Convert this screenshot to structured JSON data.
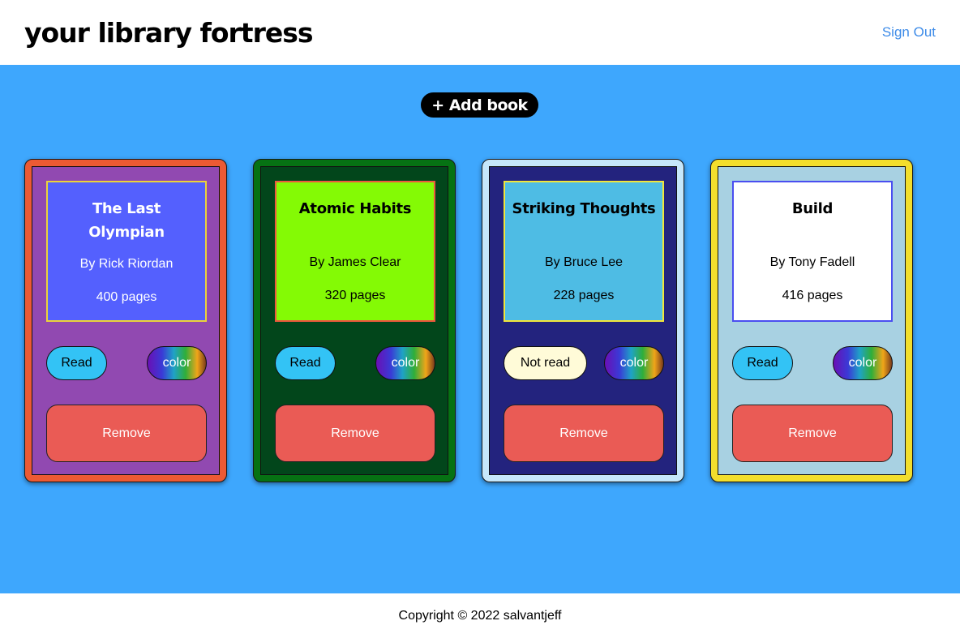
{
  "header": {
    "logo": "your library fortress",
    "sign_out": "Sign Out"
  },
  "main": {
    "add_book_label": "+ Add book"
  },
  "books": [
    {
      "title": "The Last Olympian",
      "author": "By Rick Riordan",
      "pages": "400 pages",
      "status": "Read",
      "color_label": "color",
      "remove_label": "Remove",
      "colors": {
        "outer": "#ec5a33",
        "inner": "#9149b1",
        "info_bg": "#5460fe",
        "info_border": "#ecd33a",
        "title_color": "#ffffff",
        "text_color": "#ffffff"
      }
    },
    {
      "title": "Atomic Habits",
      "author": "By James Clear",
      "pages": "320 pages",
      "status": "Read",
      "color_label": "color",
      "remove_label": "Remove",
      "colors": {
        "outer": "#067213",
        "inner": "#02461b",
        "info_bg": "#84fa05",
        "info_border": "#ee573f",
        "title_color": "#000000",
        "text_color": "#000000"
      }
    },
    {
      "title": "Striking Thoughts",
      "author": "By Bruce Lee",
      "pages": "228 pages",
      "status": "Not read",
      "color_label": "color",
      "remove_label": "Remove",
      "colors": {
        "outer": "#c6e7fb",
        "inner": "#23237e",
        "info_bg": "#4ebce4",
        "info_border": "#f2e53a",
        "title_color": "#000000",
        "text_color": "#000000"
      }
    },
    {
      "title": "Build",
      "author": "By Tony Fadell",
      "pages": "416 pages",
      "status": "Read",
      "color_label": "color",
      "remove_label": "Remove",
      "colors": {
        "outer": "#f3de2c",
        "inner": "#a8d1e2",
        "info_bg": "#ffffff",
        "info_border": "#4a4ef0",
        "title_color": "#000000",
        "text_color": "#000000"
      }
    }
  ],
  "footer": {
    "copyright": "Copyright © 2022 salvantjeff"
  }
}
